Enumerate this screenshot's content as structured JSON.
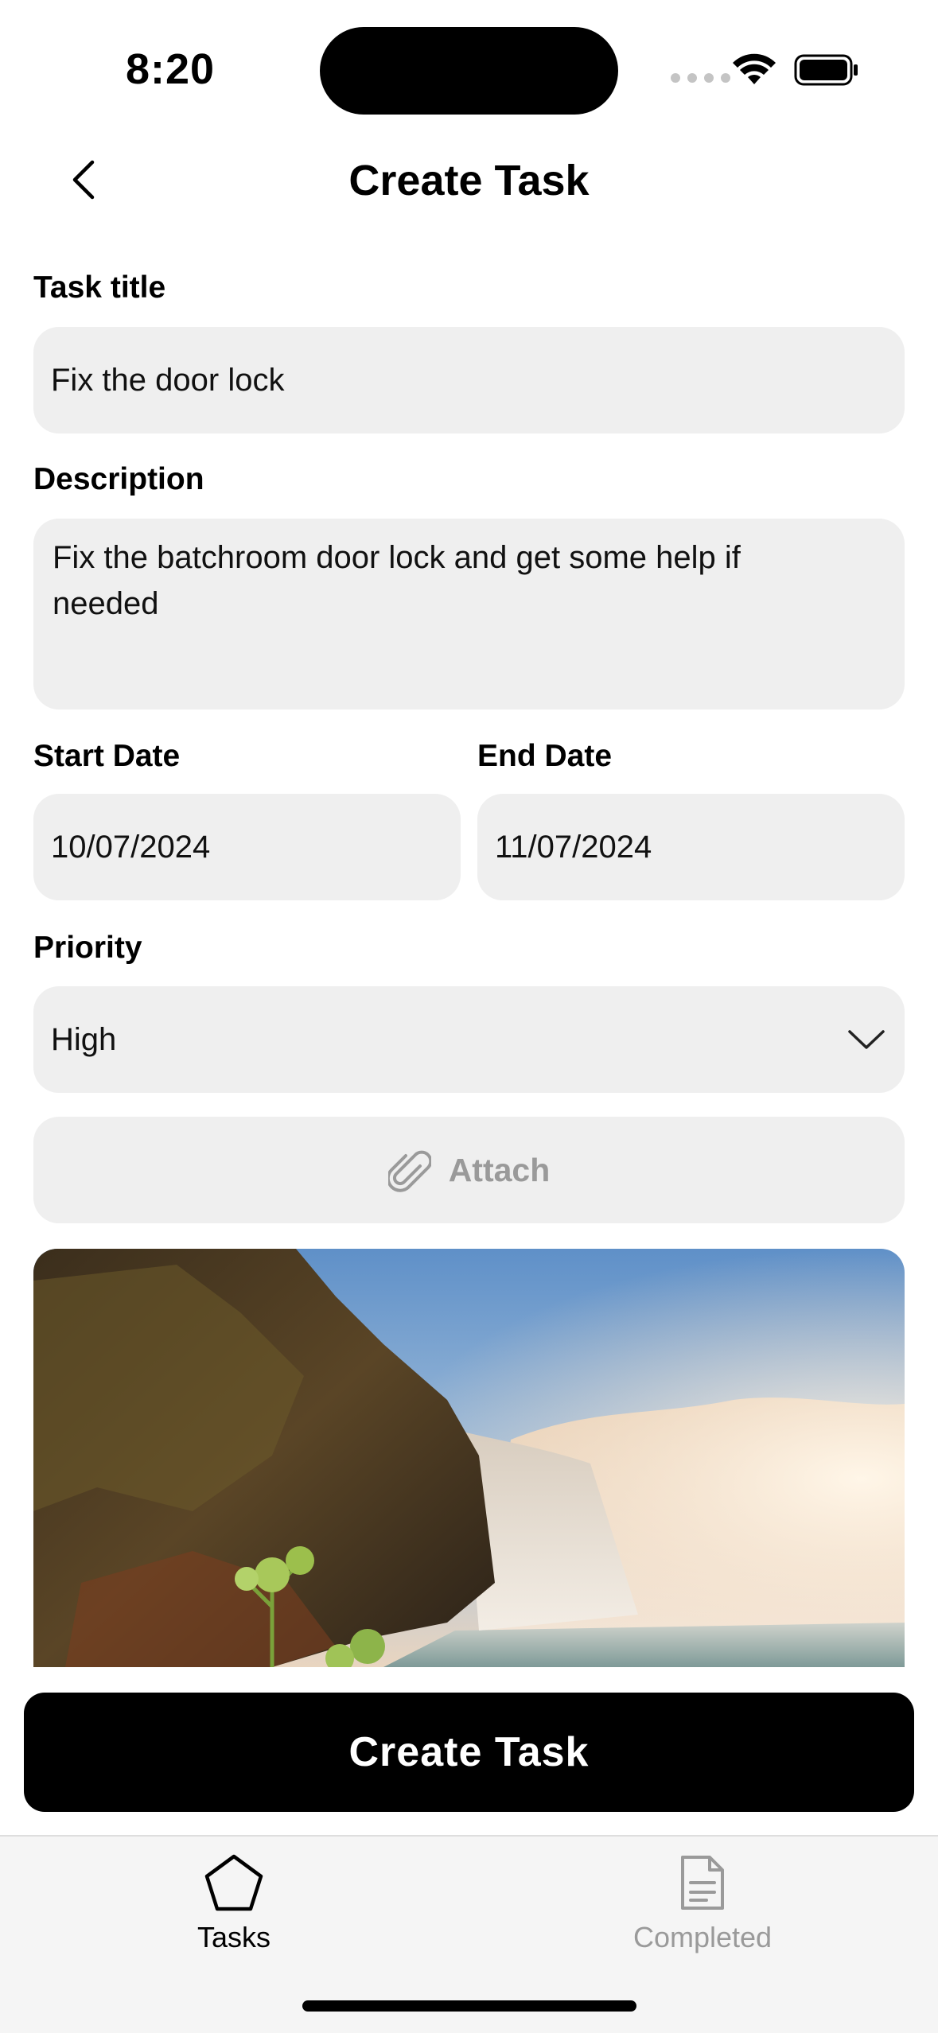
{
  "status_bar": {
    "time": "8:20"
  },
  "header": {
    "title": "Create Task",
    "back_icon": "chevron-left-icon"
  },
  "form": {
    "task_title": {
      "label": "Task title",
      "value": "Fix the door lock"
    },
    "description": {
      "label": "Description",
      "value": "Fix the batchroom door lock and get some help if needed"
    },
    "start_date": {
      "label": "Start Date",
      "value": "10/07/2024"
    },
    "end_date": {
      "label": "End Date",
      "value": "11/07/2024"
    },
    "priority": {
      "label": "Priority",
      "selected": "High"
    },
    "attach": {
      "label": "Attach",
      "icon": "paperclip-icon"
    },
    "attachment": {
      "image": "waterfall-photo"
    }
  },
  "cta": {
    "label": "Create Task"
  },
  "tabbar": {
    "items": [
      {
        "label": "Tasks",
        "icon": "pentagon-icon",
        "active": true
      },
      {
        "label": "Completed",
        "icon": "document-icon",
        "active": false
      }
    ]
  },
  "colors": {
    "field_bg": "#efefef",
    "primary": "#000000",
    "muted": "#9a9a9a"
  }
}
